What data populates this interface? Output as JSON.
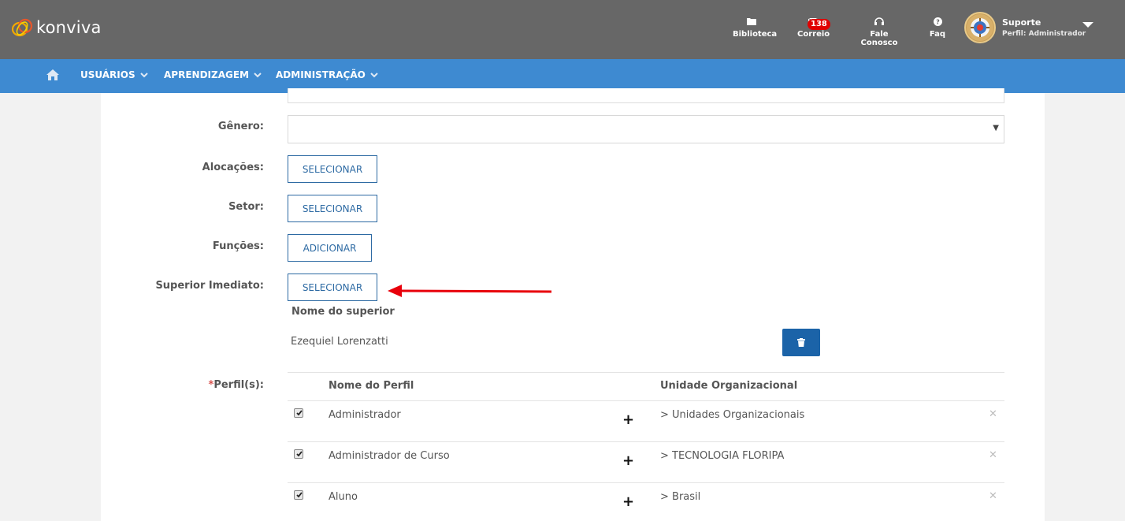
{
  "header": {
    "brand": "konviva",
    "items": [
      {
        "id": "biblioteca",
        "label": "Biblioteca",
        "icon": "folder-icon"
      },
      {
        "id": "correio",
        "label": "Correio",
        "icon": "envelope-icon",
        "badge": "138"
      },
      {
        "id": "fale",
        "label": "Fale Conosco",
        "icon": "headset-icon"
      },
      {
        "id": "faq",
        "label": "Faq",
        "icon": "question-icon"
      }
    ],
    "user": {
      "name": "Suporte",
      "role": "Perfil: Administrador"
    }
  },
  "nav": {
    "items": [
      {
        "label": "USUÁRIOS"
      },
      {
        "label": "APRENDIZAGEM"
      },
      {
        "label": "ADMINISTRAÇÃO"
      }
    ]
  },
  "form": {
    "genero_label": "Gênero:",
    "genero_value": "",
    "alocacoes_label": "Alocações:",
    "alocacoes_button": "SELECIONAR",
    "setor_label": "Setor:",
    "setor_button": "SELECIONAR",
    "funcoes_label": "Funções:",
    "funcoes_button": "ADICIONAR",
    "superior_label": "Superior Imediato:",
    "superior_button": "SELECIONAR",
    "superior_col_header": "Nome do superior",
    "superior_name": "Ezequiel Lorenzatti",
    "perfis_required_mark": "*",
    "perfis_label": "Perfil(s):",
    "perfis_headers": {
      "nome": "Nome do Perfil",
      "unidade": "Unidade Organizacional"
    },
    "perfis_rows": [
      {
        "checked": true,
        "nome": "Administrador",
        "unidade": "> Unidades Organizacionais"
      },
      {
        "checked": true,
        "nome": "Administrador de Curso",
        "unidade": "> TECNOLOGIA FLORIPA"
      },
      {
        "checked": true,
        "nome": "Aluno",
        "unidade": "> Brasil"
      }
    ]
  },
  "colors": {
    "topbar": "#676767",
    "navbar": "#3e8ad1",
    "button_border": "#2d6aa3",
    "trash_button": "#1b63a8",
    "annotation_arrow": "#e8000b"
  }
}
